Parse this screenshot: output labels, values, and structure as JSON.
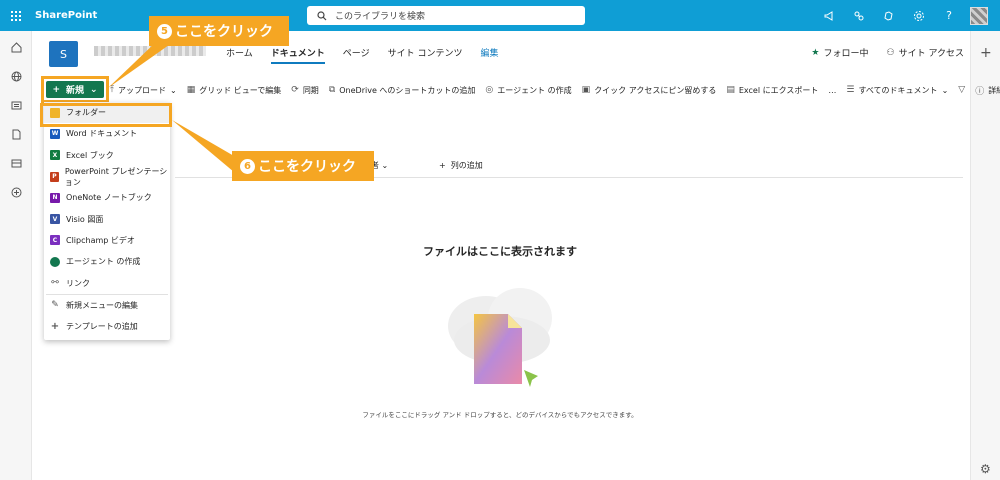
{
  "topbar": {
    "app_name": "SharePoint",
    "search_placeholder": "このライブラリを検索",
    "icons": [
      "megaphone-icon",
      "network-icon",
      "copilot-icon",
      "settings-icon",
      "help-icon"
    ],
    "help_label": "?"
  },
  "site": {
    "logo_letter": "S",
    "nav": [
      "ホーム",
      "ドキュメント",
      "ページ",
      "サイト コンテンツ",
      "編集"
    ],
    "follow_label": "フォロー中",
    "access_label": "サイト アクセス"
  },
  "commandbar": {
    "new_label": "新規",
    "items": [
      {
        "label": "アップロード",
        "icon": "upload-icon",
        "caret": "⌄"
      },
      {
        "label": "グリッド ビューで編集",
        "icon": "grid-icon"
      },
      {
        "label": "同期",
        "icon": "sync-icon"
      },
      {
        "label": "OneDrive へのショートカットの追加",
        "icon": "shortcut-icon"
      },
      {
        "label": "エージェント の作成",
        "icon": "agent-icon"
      },
      {
        "label": "クイック アクセスにピン留めする",
        "icon": "pin-icon"
      },
      {
        "label": "Excel にエクスポート",
        "icon": "excel-icon"
      },
      {
        "label": "…",
        "icon": "more-icon"
      },
      {
        "label": "すべてのドキュメント",
        "icon": "view-icon",
        "caret": "⌄"
      },
      {
        "label": "",
        "icon": "filter-icon"
      },
      {
        "label": "詳細",
        "icon": "info-icon"
      },
      {
        "label": "",
        "icon": "expand-icon"
      }
    ]
  },
  "new_menu": {
    "items": [
      {
        "label": "フォルダー",
        "icon": "folder-icon",
        "color": "#f0b429"
      },
      {
        "label": "Word ドキュメント",
        "icon": "word-icon",
        "color": "#185abd"
      },
      {
        "label": "Excel ブック",
        "icon": "excel-icon",
        "color": "#107c41"
      },
      {
        "label": "PowerPoint プレゼンテーション",
        "icon": "powerpoint-icon",
        "color": "#c43e1c"
      },
      {
        "label": "OneNote ノートブック",
        "icon": "onenote-icon",
        "color": "#7719aa"
      },
      {
        "label": "Visio 図面",
        "icon": "visio-icon",
        "color": "#3955a3"
      },
      {
        "label": "Clipchamp ビデオ",
        "icon": "clipchamp-icon",
        "color": "#7b2fbf"
      },
      {
        "label": "エージェント の作成",
        "icon": "agent-icon",
        "color": "#13774f"
      },
      {
        "label": "リンク",
        "icon": "link-icon",
        "color": "#555555"
      }
    ],
    "footer": [
      {
        "label": "新規メニューの編集",
        "icon": "pencil-icon"
      },
      {
        "label": "テンプレートの追加",
        "icon": "plus-icon"
      }
    ]
  },
  "list": {
    "column_header": "者",
    "add_column": "列の追加",
    "empty_title": "ファイルはここに表示されます",
    "empty_subtitle": "ファイルをここにドラッグ アンド ドロップすると、どのデバイスからでもアクセスできます。"
  },
  "callouts": [
    {
      "number": "5",
      "text": "ここをクリック"
    },
    {
      "number": "6",
      "text": "ここをクリック"
    }
  ],
  "colors": {
    "suite_bar": "#0f9ed5",
    "new_button": "#13774f",
    "callout": "#f5a623",
    "accent": "#0f7bbf"
  }
}
